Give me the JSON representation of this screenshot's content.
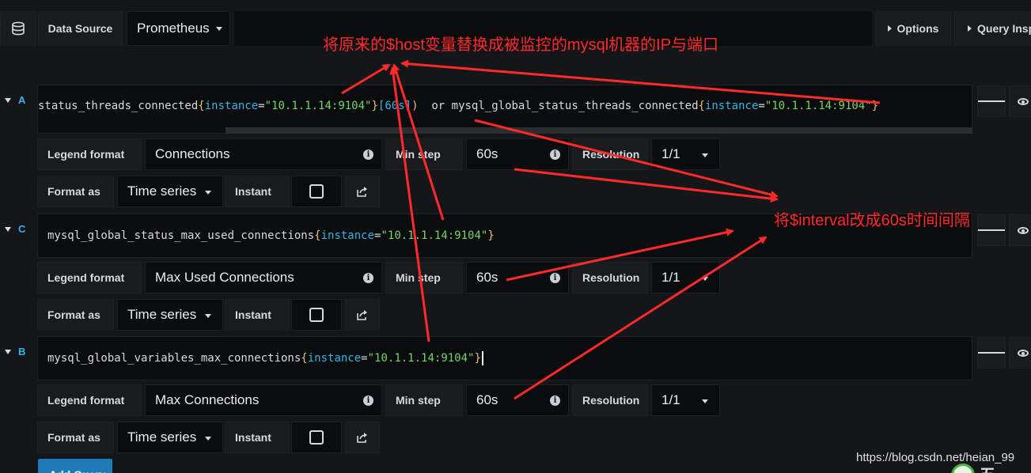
{
  "toolbar": {
    "icon": "database-icon",
    "datasource_label": "Data Source",
    "datasource_value": "Prometheus",
    "options_label": "Options",
    "query_inspector_label": "Query Insp"
  },
  "queries": [
    {
      "letter": "A",
      "expr_tokens": [
        {
          "t": "status_threads_connected",
          "c": "m"
        },
        {
          "t": "{",
          "c": "b"
        },
        {
          "t": "instance",
          "c": "k"
        },
        {
          "t": "=",
          "c": "op"
        },
        {
          "t": "\"10.1.1.14:9104\"",
          "c": "s"
        },
        {
          "t": "}",
          "c": "b"
        },
        {
          "t": "[60s]",
          "c": "k"
        },
        {
          "t": ")",
          "c": "b"
        },
        {
          "t": "  or mysql_global_status_threads_connected",
          "c": "m"
        },
        {
          "t": "{",
          "c": "b"
        },
        {
          "t": "instance",
          "c": "k"
        },
        {
          "t": "=",
          "c": "op"
        },
        {
          "t": "\"10.1.1.14:9104\"",
          "c": "s"
        },
        {
          "t": "}",
          "c": "b"
        }
      ],
      "legend_label": "Legend format",
      "legend_value": "Connections",
      "minstep_label": "Min step",
      "minstep_value": "60s",
      "resolution_label": "Resolution",
      "resolution_value": "1/1",
      "format_label": "Format as",
      "format_value": "Time series",
      "instant_label": "Instant"
    },
    {
      "letter": "C",
      "expr_tokens": [
        {
          "t": "mysql_global_status_max_used_connections",
          "c": "m"
        },
        {
          "t": "{",
          "c": "b"
        },
        {
          "t": "instance",
          "c": "k"
        },
        {
          "t": "=",
          "c": "op"
        },
        {
          "t": "\"10.1.1.14:9104\"",
          "c": "s"
        },
        {
          "t": "}",
          "c": "b"
        }
      ],
      "legend_label": "Legend format",
      "legend_value": "Max Used Connections",
      "minstep_label": "Min step",
      "minstep_value": "60s",
      "resolution_label": "Resolution",
      "resolution_value": "1/1",
      "format_label": "Format as",
      "format_value": "Time series",
      "instant_label": "Instant"
    },
    {
      "letter": "B",
      "expr_tokens": [
        {
          "t": "mysql_global_variables_max_connections",
          "c": "m"
        },
        {
          "t": "{",
          "c": "b"
        },
        {
          "t": "instance",
          "c": "k"
        },
        {
          "t": "=",
          "c": "op"
        },
        {
          "t": "\"10.1.1.14:9104\"",
          "c": "s"
        },
        {
          "t": "}",
          "c": "b"
        }
      ],
      "legend_label": "Legend format",
      "legend_value": "Max Connections",
      "minstep_label": "Min step",
      "minstep_value": "60s",
      "resolution_label": "Resolution",
      "resolution_value": "1/1",
      "format_label": "Format as",
      "format_value": "Time series",
      "instant_label": "Instant"
    }
  ],
  "add_query_label": "Add Query",
  "annotations": {
    "host_note": "将原来的$host变量替换成被监控的mysql机器的IP与端口",
    "interval_note": "将$interval改成60s时间间隔"
  },
  "watermark": "https://blog.csdn.net/heian_99",
  "logo_text": "五",
  "colors": {
    "background": "#141619",
    "panel": "#0b0c0e",
    "accent_blue": "#33b5e5",
    "string_green": "#73d46a",
    "brace_yellow": "#e5c07b",
    "annotation_red": "#ff2a2a",
    "button_blue": "#1f7bb8"
  }
}
